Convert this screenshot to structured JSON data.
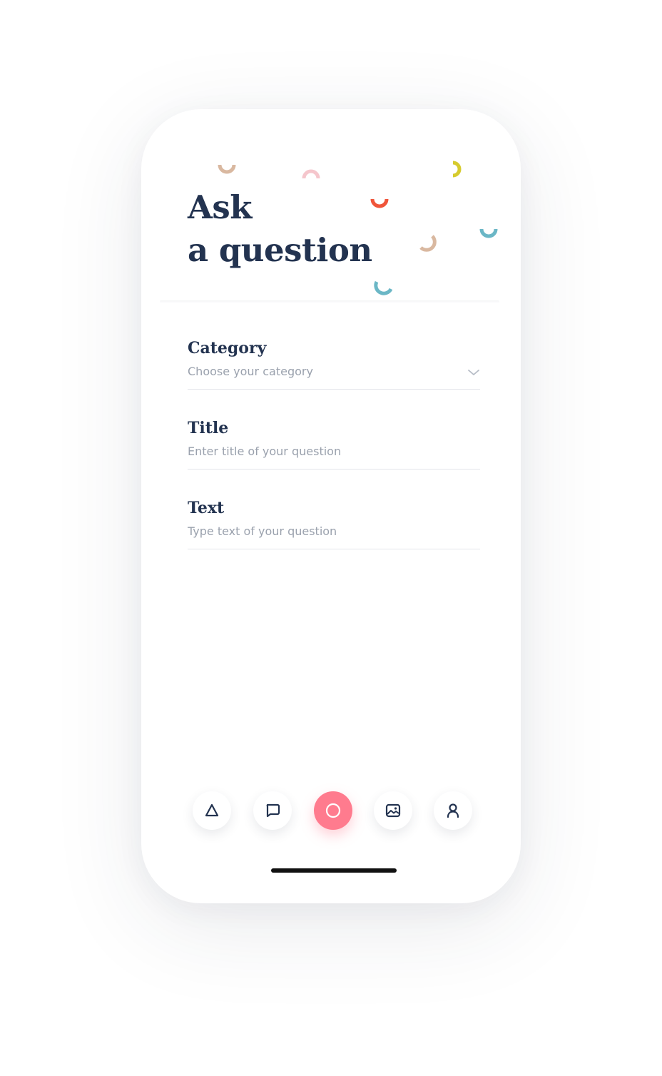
{
  "screen": {
    "title_line1": "Ask",
    "title_line2": "a question"
  },
  "form": {
    "category": {
      "label": "Category",
      "placeholder": "Choose your category",
      "icon": "chevron-down-icon"
    },
    "title": {
      "label": "Title",
      "placeholder": "Enter title of your question"
    },
    "text": {
      "label": "Text",
      "placeholder": "Type text of your question"
    }
  },
  "tab_bar": {
    "active_index": 2,
    "items": [
      {
        "name": "home",
        "icon": "triangle-icon"
      },
      {
        "name": "messages",
        "icon": "chat-bubble-icon"
      },
      {
        "name": "ask-question",
        "icon": "circle-icon"
      },
      {
        "name": "gallery",
        "icon": "image-icon"
      },
      {
        "name": "profile",
        "icon": "user-icon"
      }
    ]
  },
  "colors": {
    "text_dark": "#233350",
    "placeholder": "#9aa1ad",
    "accent_pink": "#ff7b8e",
    "confetti_tan": "#d9b8a0",
    "confetti_pink": "#f5c6cc",
    "confetti_yellow": "#d6cb2e",
    "confetti_red": "#f0553a",
    "confetti_teal": "#6bb7c6"
  }
}
